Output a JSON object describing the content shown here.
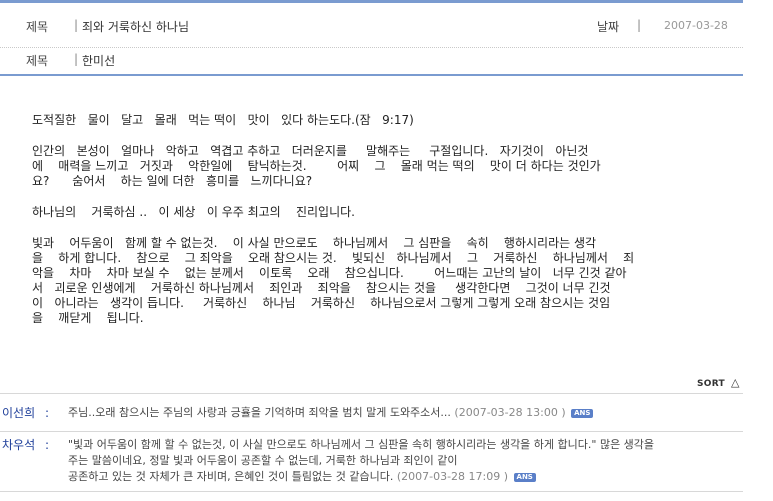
{
  "header": {
    "title_label": "제목",
    "separator": "|",
    "title_value": "죄와 거룩하신 하나님",
    "date_label": "날짜",
    "date_value": "2007-03-28",
    "author_label": "제목",
    "author_value": "한미선"
  },
  "body": {
    "paragraphs": [
      [
        "도적질한   물이   달고   몰래   먹는 떡이   맛이   있다 하는도다.(잠   9:17)"
      ],
      [
        "인간의   본성이   얼마나   악하고   역겹고 추하고   더러운지를     말해주는     구절입니다.   자기것이   아닌것",
        "에    매력을 느끼고   거짓과    악한일에    탐닉하는것.        어찌    그    몰래 먹는 떡의    맛이 더 하다는 것인가",
        "요?      숨어서    하는 일에 더한   흥미를   느끼다니요?"
      ],
      [
        "하나님의    거룩하심 ..   이 세상   이 우주 최고의    진리입니다."
      ],
      [
        "빛과    어두움이   함께 할 수 없는것.    이 사실 만으로도    하나님께서    그 심판을    속히    행하시리라는 생각",
        "을    하게 합니다.    참으로    그 죄악을    오래 참으시는 것.    빛되신   하나님께서    그    거룩하신    하나님께서    죄",
        "악을    차마    차마 보실 수    없는 분께서    이토록    오래    참으십니다.        어느때는 고난의 날이   너무 긴것 같아",
        "서   괴로운 인생에게    거룩하신 하나님께서    죄인과    죄악을    참으시는 것을     생각한다면    그것이 너무 긴것",
        "이   아니라는   생각이 듭니다.     거룩하신    하나님    거룩하신    하나님으로서 그렇게 그렇게 오래 참으시는 것임",
        "을    깨닫게    됩니다."
      ]
    ]
  },
  "sort_label": "SORT",
  "sort_icon": "triangle-up-icon",
  "comments": [
    {
      "author": "이선희",
      "colon": ":",
      "lines": [
        "주님..오래 참으시는 주님의 사랑과 긍휼을 기억하며 죄악을 범치 말게 도와주소서..."
      ],
      "date": "(2007-03-28 13:00 )",
      "badge": "ANS"
    },
    {
      "author": "차우석",
      "colon": ":",
      "lines": [
        "\"빛과 어두움이 함께 할 수 없는것, 이 사실 만으로도 하나님께서 그 심판을 속히 행하시리라는 생각을 하게 합니다.\" 많은 생각을",
        "주는 말씀이네요, 정말 빛과 어두움이 공존할 수 없는데, 거룩한 하나님과 죄인이 같이",
        "공존하고 있는 것 자체가 큰 자비며, 은혜인 것이 틀림없는 것 같습니다."
      ],
      "date": "(2007-03-28 17:09 )",
      "badge": "ANS"
    }
  ],
  "colors": {
    "accent": "#7a9bd0",
    "author": "#1f3f9a",
    "badge": "#5a7fc8"
  }
}
